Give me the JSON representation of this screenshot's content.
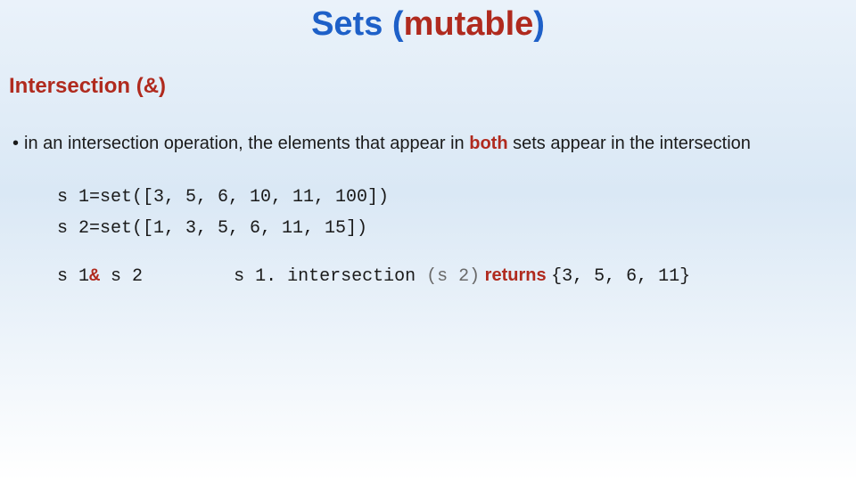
{
  "title": {
    "t1": "Sets (",
    "t2": "mutable",
    "t3": ")"
  },
  "subtitle": "Intersection (&)",
  "bullet": {
    "pre": "in an intersection operation, the elements that appear in ",
    "both": "both",
    "post": " sets appear in the intersection"
  },
  "code": {
    "line1": "s 1=set([3, 5, 6, 10, 11, 100])",
    "line2": "s 2=set([1, 3, 5, 6, 11, 15])"
  },
  "expr": {
    "left_s1": "s 1",
    "amp": "& ",
    "left_s2": "s 2",
    "method": "s 1. intersection ",
    "arg": "(s 2)",
    "returns": " returns ",
    "result": " {3, 5, 6, 11}"
  }
}
